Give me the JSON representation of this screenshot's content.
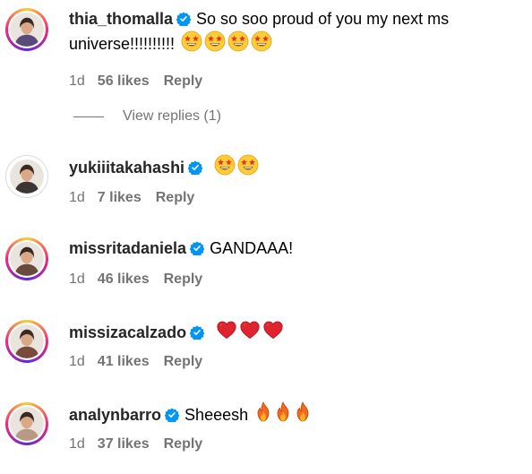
{
  "comments": [
    {
      "username": "thia_thomalla",
      "text": "So so soo proud of you my next ms universe!!!!!!!!!!",
      "emoji": [
        "star-struck",
        "star-struck",
        "star-struck",
        "star-struck"
      ],
      "age": "1d",
      "likes": "56 likes",
      "reply": "Reply",
      "avatar_color": "#5a4a7a",
      "ring": "story"
    },
    {
      "username": "yukiiitakahashi",
      "text": "",
      "emoji": [
        "star-struck",
        "star-struck"
      ],
      "age": "1d",
      "likes": "7 likes",
      "reply": "Reply",
      "avatar_color": "#3b3535",
      "ring": "plain"
    },
    {
      "username": "missritadaniela",
      "text": "GANDAAA!",
      "emoji": [],
      "age": "1d",
      "likes": "46 likes",
      "reply": "Reply",
      "avatar_color": "#6a4a3a",
      "ring": "story"
    },
    {
      "username": "missizacalzado",
      "text": "",
      "emoji": [
        "red-heart",
        "red-heart",
        "red-heart"
      ],
      "age": "1d",
      "likes": "41 likes",
      "reply": "Reply",
      "avatar_color": "#7a4a3a",
      "ring": "story"
    },
    {
      "username": "analynbarro",
      "text": "Sheeesh",
      "emoji": [
        "fire",
        "fire",
        "fire"
      ],
      "age": "1d",
      "likes": "37 likes",
      "reply": "Reply",
      "avatar_color": "#b89a84",
      "ring": "story"
    }
  ],
  "view_replies": "View replies (1)",
  "colors": {
    "verified": "#0095f6",
    "meta": "#737373",
    "username": "#262626"
  }
}
